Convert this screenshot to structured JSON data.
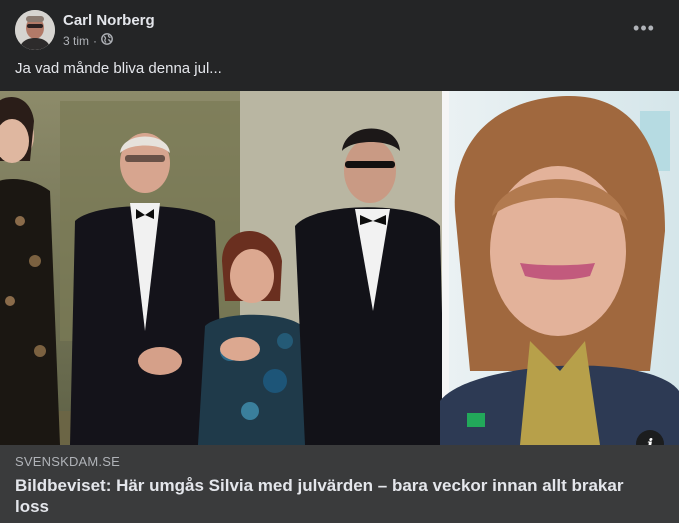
{
  "post": {
    "author": "Carl Norberg",
    "time": "3 tim",
    "separator": "·",
    "audience_icon": "globe-icon",
    "more_icon": "more-horizontal-icon",
    "more_glyph": "•••",
    "text": "Ja vad månde bliva denna jul..."
  },
  "link": {
    "domain": "SVENSKDAM.SE",
    "headline": "Bildbeviset: Här umgås Silvia med julvärden – bara veckor innan allt brakar loss",
    "info_glyph": "i",
    "info_icon": "info-icon"
  },
  "colors": {
    "card_bg": "#242526",
    "link_bg": "#3a3b3c",
    "primary_text": "#e4e6eb",
    "secondary_text": "#b0b3b8"
  }
}
